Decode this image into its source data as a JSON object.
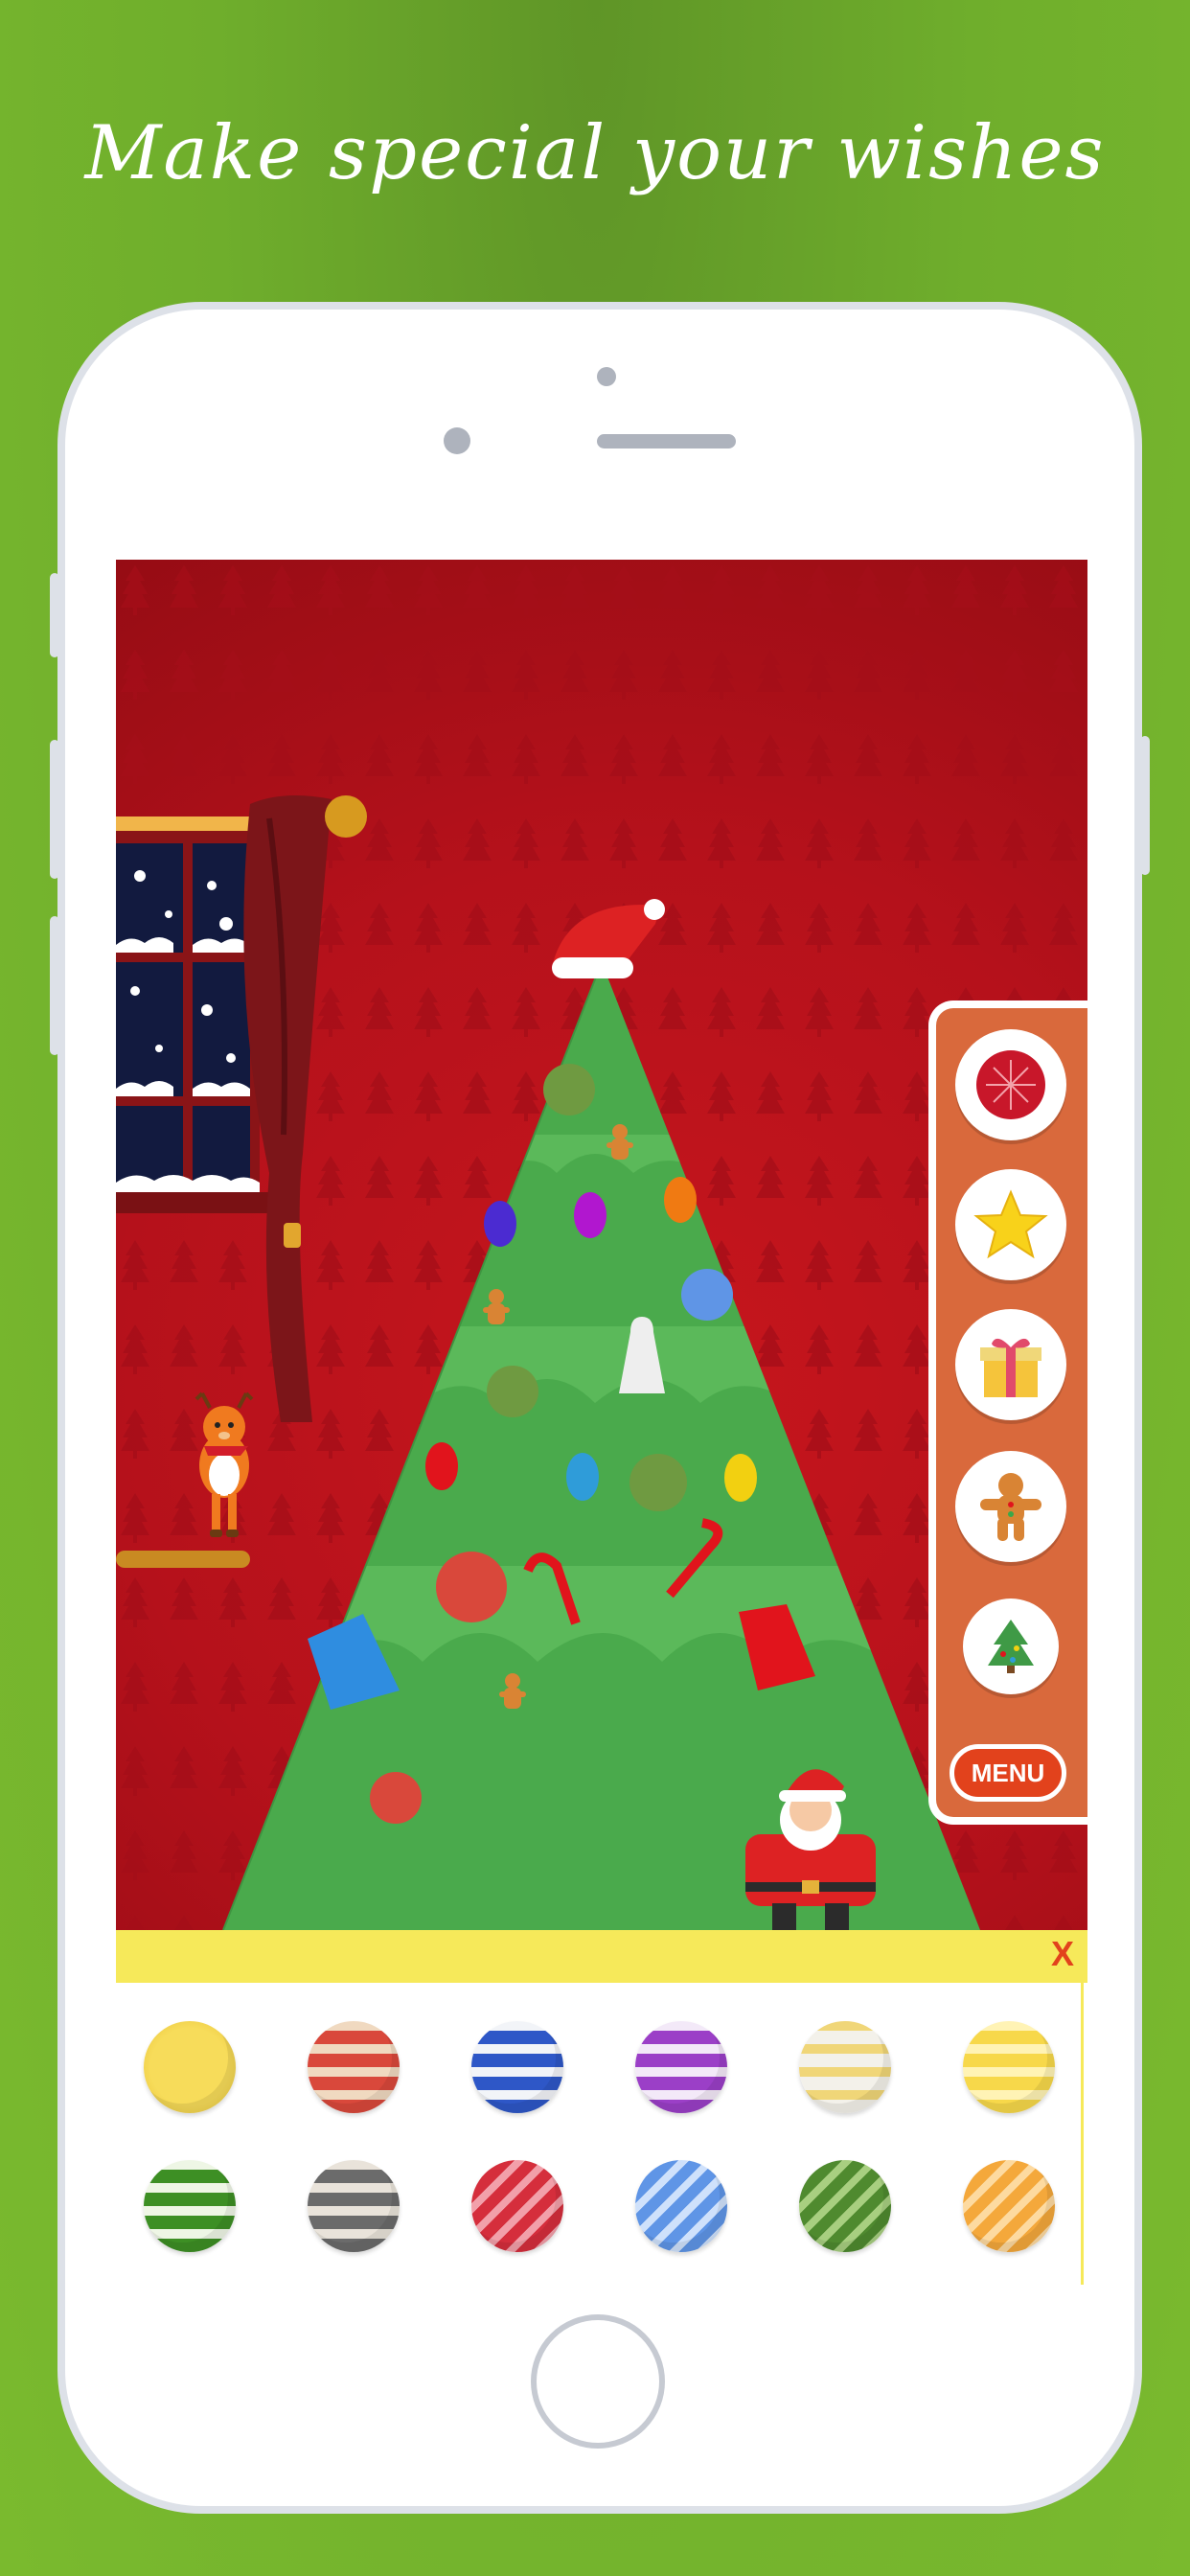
{
  "headline": "Make special your wishes",
  "side_menu": {
    "items": [
      {
        "name": "ornament-ball-icon"
      },
      {
        "name": "star-icon"
      },
      {
        "name": "gift-box-icon"
      },
      {
        "name": "gingerbread-man-icon"
      },
      {
        "name": "christmas-tree-icon"
      }
    ],
    "menu_label": "MENU"
  },
  "tray": {
    "close_label": "X",
    "balls": [
      {
        "name": "ball-yellow-snowflake",
        "colors": [
          "#f7dc5a",
          "#e9c236"
        ]
      },
      {
        "name": "ball-red-stripes",
        "colors": [
          "#d9483b",
          "#f0d9c0"
        ]
      },
      {
        "name": "ball-blue-stripes",
        "colors": [
          "#2e57c7",
          "#f2f4f8"
        ]
      },
      {
        "name": "ball-purple-stripes",
        "colors": [
          "#9b3fc7",
          "#f3e9f8"
        ]
      },
      {
        "name": "ball-white-stripes",
        "colors": [
          "#f3f1ea",
          "#f0d678"
        ]
      },
      {
        "name": "ball-yellow-stripes",
        "colors": [
          "#f7d84a",
          "#fff3b5"
        ]
      },
      {
        "name": "ball-green-stripes",
        "colors": [
          "#3d8f24",
          "#eef6e5"
        ]
      },
      {
        "name": "ball-gray-stripes",
        "colors": [
          "#6b6b6b",
          "#e9e3da"
        ]
      },
      {
        "name": "ball-red-diagonal",
        "colors": [
          "#d52e3c",
          "#f2a0aa"
        ]
      },
      {
        "name": "ball-lightblue-diagonal",
        "colors": [
          "#5f95e6",
          "#cfe1fb"
        ]
      },
      {
        "name": "ball-olive-diagonal",
        "colors": [
          "#4f8a2f",
          "#a8cf80"
        ]
      },
      {
        "name": "ball-orange-diagonal",
        "colors": [
          "#f4a83b",
          "#fddaa0"
        ]
      }
    ]
  },
  "colors": {
    "background": "#6fae2c",
    "wall": "#b5111b",
    "tree": "#4aaa4c",
    "side_panel": "#d9693c",
    "tray_bar": "#f6e95a",
    "accent": "#e2421c"
  }
}
